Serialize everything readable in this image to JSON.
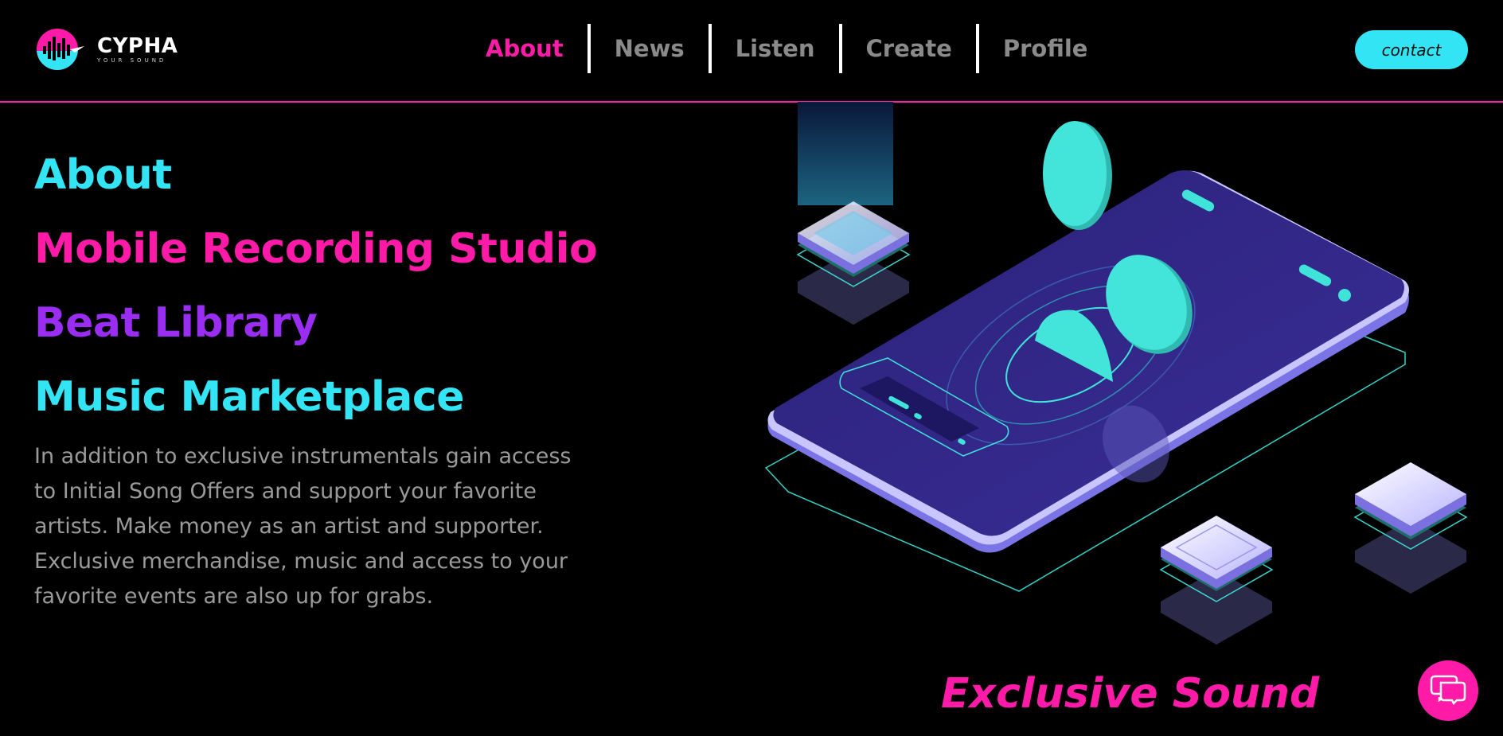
{
  "brand": {
    "name": "CYPHA",
    "tagline": "YOUR SOUND",
    "logo_icon": "soundwave-logo"
  },
  "nav": {
    "items": [
      {
        "label": "About",
        "active": true
      },
      {
        "label": "News",
        "active": false
      },
      {
        "label": "Listen",
        "active": false
      },
      {
        "label": "Create",
        "active": false
      },
      {
        "label": "Profile",
        "active": false
      }
    ]
  },
  "header": {
    "contact_label": "contact"
  },
  "hero": {
    "headings": [
      "About",
      "Mobile Recording Studio",
      "Beat Library",
      "Music Marketplace"
    ],
    "description": "In addition to exclusive instrumentals gain access to Initial Song Offers and support your favorite artists. Make money as an artist and supporter. Exclusive merchandise, music and access to your favorite events are also up for grabs.",
    "tagline": "Exclusive Sound"
  },
  "chat": {
    "icon": "chat-bubbles-icon"
  },
  "colors": {
    "accent_pink": "#ff1aa8",
    "accent_cyan": "#33e5f4",
    "accent_purple": "#9a2df2",
    "background": "#000000",
    "nav_inactive": "#8a8a8a",
    "body_text": "#9a9a9a"
  }
}
